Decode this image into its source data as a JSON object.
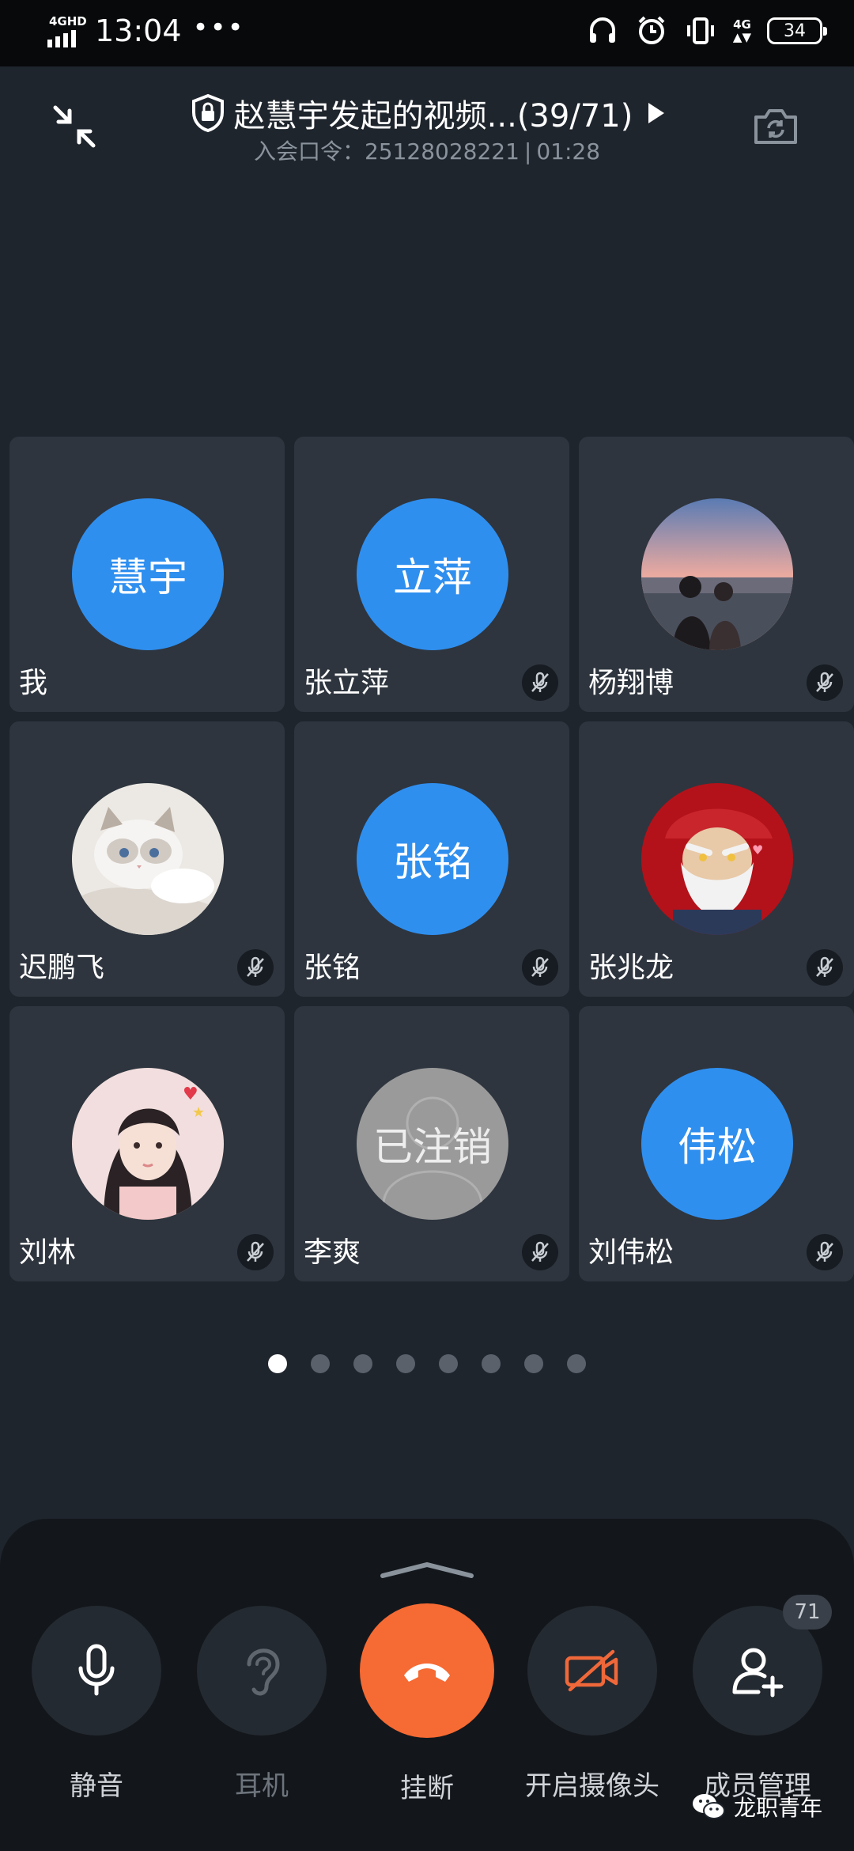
{
  "status_bar": {
    "network": "4GHD",
    "time": "13:04",
    "more": "•••",
    "network_right": "4G",
    "battery": "34",
    "icons": [
      "headset-icon",
      "alarm-icon",
      "vibrate-icon"
    ]
  },
  "header": {
    "title": "赵慧宇发起的视频...(39/71)",
    "code_label": "入会口令：25128028221",
    "separator": "|",
    "duration": "01:28"
  },
  "participants": [
    {
      "name": "我",
      "avatar_text": "慧宇",
      "avatar": "blue",
      "muted": false
    },
    {
      "name": "张立萍",
      "avatar_text": "立萍",
      "avatar": "blue",
      "muted": true
    },
    {
      "name": "杨翔博",
      "avatar_text": "",
      "avatar": "photo-sunset-couple",
      "muted": true
    },
    {
      "name": "迟鹏飞",
      "avatar_text": "",
      "avatar": "photo-white-cat",
      "muted": true
    },
    {
      "name": "张铭",
      "avatar_text": "张铭",
      "avatar": "blue",
      "muted": true
    },
    {
      "name": "张兆龙",
      "avatar_text": "",
      "avatar": "photo-bearded-character",
      "muted": true
    },
    {
      "name": "刘林",
      "avatar_text": "",
      "avatar": "photo-girl",
      "muted": true
    },
    {
      "name": "李爽",
      "avatar_text": "已注销",
      "avatar": "gray",
      "muted": true
    },
    {
      "name": "刘伟松",
      "avatar_text": "伟松",
      "avatar": "blue",
      "muted": true
    }
  ],
  "pagination": {
    "total": 8,
    "current": 1
  },
  "controls": {
    "mute": "静音",
    "earpiece": "耳机",
    "hangup": "挂断",
    "camera": "开启摄像头",
    "members": "成员管理",
    "members_count": "71"
  },
  "watermark": "龙职青年",
  "colors": {
    "accent_blue": "#2f8fef",
    "hangup_orange": "#f66a33",
    "background": "#1f252d"
  }
}
